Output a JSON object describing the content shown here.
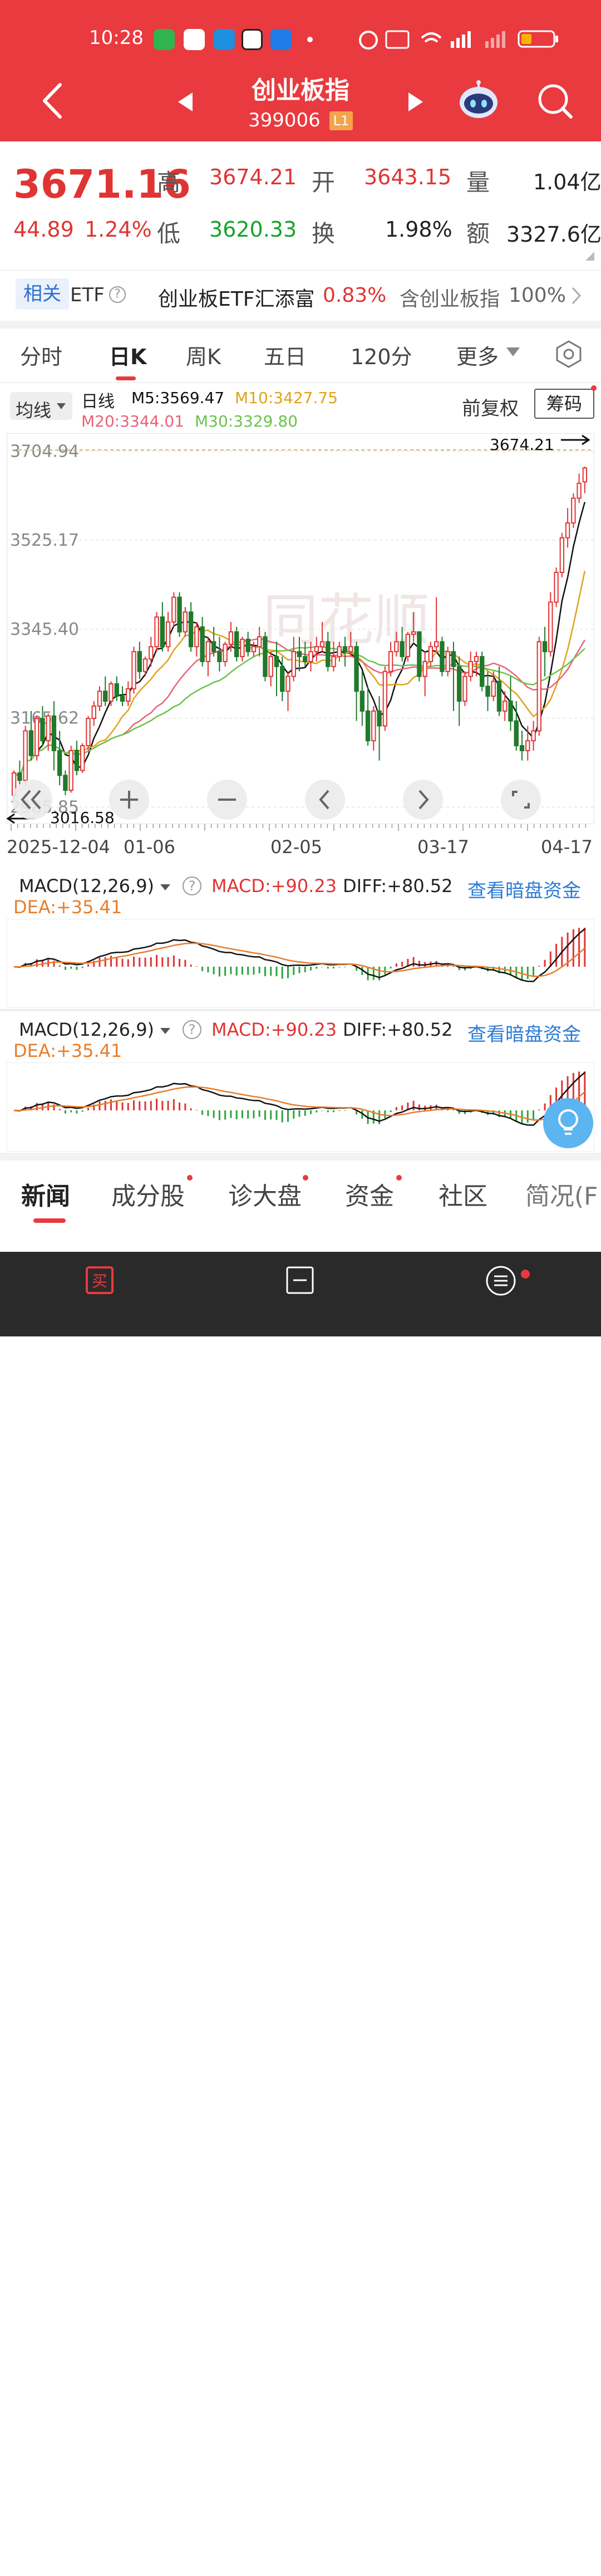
{
  "status_bar": {
    "time": "10:28",
    "icons": [
      "phone-icon",
      "home-app-icon",
      "radar-app-icon",
      "mail-app-icon",
      "alipay-icon",
      "alarm-icon",
      "hd-icon",
      "wifi-icon",
      "signal-icon",
      "battery-icon"
    ]
  },
  "header": {
    "title": "创业板指",
    "code": "399006",
    "level_badge": "L1"
  },
  "quote": {
    "price": "3671.16",
    "change": "44.89",
    "change_pct": "1.24%",
    "high_label": "高",
    "high": "3674.21",
    "low_label": "低",
    "low": "3620.33",
    "open_label": "开",
    "open": "3643.15",
    "turnover_label": "换",
    "turnover": "1.98%",
    "volume_label": "量",
    "volume": "1.04亿",
    "amount_label": "额",
    "amount": "3327.6亿"
  },
  "etf_bar": {
    "tag": "相关",
    "etf": "ETF",
    "name": "创业板ETF汇添富",
    "pct": "0.83%",
    "contains": "含创业板指",
    "contains_pct": "100%"
  },
  "chart_tabs": [
    "分时",
    "日K",
    "周K",
    "五日",
    "120分",
    "更多"
  ],
  "selected_tab": "日K",
  "ma_bar": {
    "select": "均线",
    "period": "日线",
    "m5": "M5:3569.47",
    "m10": "M10:3427.75",
    "m20": "M20:3344.01",
    "m30": "M30:3329.80",
    "fuquan": "前复权",
    "chouma": "筹码"
  },
  "kchart": {
    "y_labels": [
      "3704.94",
      "3525.17",
      "3345.40",
      "3165.62",
      "2985.85"
    ],
    "high_marker": "3674.21",
    "low_marker": "3016.58",
    "x_labels": [
      "2025-12-04",
      "01-06",
      "02-05",
      "03-17",
      "04-17"
    ],
    "watermark": "同花顺",
    "colors": {
      "up": "#e03434",
      "down": "#1f7a2a",
      "ma5": "#111111",
      "ma10": "#e0a21a",
      "ma20": "#e7647a",
      "ma30": "#6dc24b"
    }
  },
  "chart_data": {
    "type": "candlestick",
    "x_labels": [
      "2025-12-04",
      "01-06",
      "02-05",
      "03-17",
      "04-17"
    ],
    "y_ticks": [
      3704.94,
      3525.17,
      3345.4,
      3165.62,
      2985.85
    ],
    "ylim": [
      2965,
      3730
    ],
    "last_close": 3671.16,
    "period_high": 3674.21,
    "period_low": 3016.58,
    "series_ma": [
      {
        "name": "M5",
        "last": 3569.47
      },
      {
        "name": "M10",
        "last": 3427.75
      },
      {
        "name": "M20",
        "last": 3344.01
      },
      {
        "name": "M30",
        "last": 3329.8
      }
    ],
    "candles": [
      [
        3010,
        3060,
        3055,
        3000
      ],
      [
        3055,
        3080,
        3040,
        3030
      ],
      [
        3040,
        3150,
        3140,
        3030
      ],
      [
        3140,
        3180,
        3090,
        3080
      ],
      [
        3090,
        3170,
        3165,
        3080
      ],
      [
        3165,
        3190,
        3120,
        3110
      ],
      [
        3120,
        3175,
        3170,
        3100
      ],
      [
        3170,
        3200,
        3100,
        3060
      ],
      [
        3100,
        3140,
        3050,
        3030
      ],
      [
        3050,
        3060,
        3020,
        3010
      ],
      [
        3020,
        3110,
        3100,
        3015
      ],
      [
        3100,
        3120,
        3060,
        3050
      ],
      [
        3060,
        3115,
        3110,
        3055
      ],
      [
        3110,
        3170,
        3165,
        3100
      ],
      [
        3165,
        3200,
        3190,
        3150
      ],
      [
        3190,
        3230,
        3220,
        3180
      ],
      [
        3220,
        3250,
        3200,
        3190
      ],
      [
        3200,
        3240,
        3235,
        3190
      ],
      [
        3235,
        3250,
        3210,
        3200
      ],
      [
        3210,
        3230,
        3200,
        3190
      ],
      [
        3200,
        3240,
        3225,
        3190
      ],
      [
        3225,
        3310,
        3300,
        3215
      ],
      [
        3300,
        3320,
        3260,
        3245
      ],
      [
        3260,
        3290,
        3285,
        3250
      ],
      [
        3285,
        3330,
        3310,
        3270
      ],
      [
        3310,
        3380,
        3370,
        3300
      ],
      [
        3370,
        3400,
        3310,
        3300
      ],
      [
        3310,
        3380,
        3360,
        3300
      ],
      [
        3360,
        3420,
        3410,
        3350
      ],
      [
        3410,
        3420,
        3340,
        3330
      ],
      [
        3340,
        3390,
        3380,
        3330
      ],
      [
        3380,
        3400,
        3310,
        3300
      ],
      [
        3310,
        3360,
        3350,
        3290
      ],
      [
        3350,
        3370,
        3280,
        3270
      ],
      [
        3280,
        3330,
        3320,
        3250
      ],
      [
        3320,
        3350,
        3300,
        3290
      ],
      [
        3300,
        3330,
        3280,
        3260
      ],
      [
        3280,
        3320,
        3315,
        3270
      ],
      [
        3315,
        3360,
        3340,
        3300
      ],
      [
        3340,
        3350,
        3290,
        3280
      ],
      [
        3290,
        3330,
        3325,
        3280
      ],
      [
        3325,
        3340,
        3300,
        3290
      ],
      [
        3300,
        3320,
        3310,
        3290
      ],
      [
        3310,
        3350,
        3330,
        3290
      ],
      [
        3330,
        3340,
        3250,
        3240
      ],
      [
        3250,
        3300,
        3290,
        3230
      ],
      [
        3290,
        3320,
        3270,
        3210
      ],
      [
        3270,
        3290,
        3220,
        3200
      ],
      [
        3220,
        3260,
        3250,
        3180
      ],
      [
        3250,
        3330,
        3300,
        3240
      ],
      [
        3300,
        3330,
        3290,
        3260
      ],
      [
        3290,
        3320,
        3280,
        3270
      ],
      [
        3280,
        3320,
        3300,
        3260
      ],
      [
        3300,
        3330,
        3310,
        3280
      ],
      [
        3310,
        3360,
        3320,
        3300
      ],
      [
        3320,
        3340,
        3270,
        3260
      ],
      [
        3270,
        3320,
        3290,
        3260
      ],
      [
        3290,
        3320,
        3310,
        3280
      ],
      [
        3310,
        3330,
        3300,
        3270
      ],
      [
        3300,
        3340,
        3310,
        3290
      ],
      [
        3310,
        3320,
        3220,
        3160
      ],
      [
        3220,
        3260,
        3180,
        3150
      ],
      [
        3180,
        3230,
        3120,
        3110
      ],
      [
        3120,
        3190,
        3180,
        3100
      ],
      [
        3180,
        3210,
        3150,
        3080
      ],
      [
        3150,
        3270,
        3260,
        3140
      ],
      [
        3260,
        3320,
        3300,
        3250
      ],
      [
        3300,
        3340,
        3320,
        3290
      ],
      [
        3320,
        3350,
        3290,
        3280
      ],
      [
        3290,
        3340,
        3335,
        3280
      ],
      [
        3335,
        3380,
        3340,
        3320
      ],
      [
        3340,
        3340,
        3250,
        3240
      ],
      [
        3250,
        3300,
        3280,
        3210
      ],
      [
        3280,
        3320,
        3310,
        3270
      ],
      [
        3310,
        3410,
        3320,
        3300
      ],
      [
        3320,
        3330,
        3260,
        3250
      ],
      [
        3260,
        3310,
        3300,
        3250
      ],
      [
        3300,
        3320,
        3270,
        3180
      ],
      [
        3270,
        3290,
        3200,
        3150
      ],
      [
        3200,
        3260,
        3250,
        3190
      ],
      [
        3250,
        3300,
        3280,
        3240
      ],
      [
        3280,
        3300,
        3290,
        3250
      ],
      [
        3290,
        3300,
        3230,
        3220
      ],
      [
        3230,
        3260,
        3210,
        3180
      ],
      [
        3210,
        3260,
        3240,
        3200
      ],
      [
        3240,
        3270,
        3180,
        3170
      ],
      [
        3180,
        3220,
        3200,
        3160
      ],
      [
        3200,
        3250,
        3160,
        3140
      ],
      [
        3160,
        3200,
        3110,
        3100
      ],
      [
        3110,
        3140,
        3100,
        3080
      ],
      [
        3100,
        3150,
        3120,
        3080
      ],
      [
        3120,
        3160,
        3140,
        3100
      ],
      [
        3140,
        3330,
        3320,
        3130
      ],
      [
        3320,
        3350,
        3300,
        3250
      ],
      [
        3300,
        3420,
        3400,
        3290
      ],
      [
        3400,
        3470,
        3460,
        3390
      ],
      [
        3460,
        3540,
        3530,
        3450
      ],
      [
        3530,
        3590,
        3560,
        3510
      ],
      [
        3560,
        3620,
        3610,
        3550
      ],
      [
        3610,
        3660,
        3640,
        3600
      ],
      [
        3643,
        3674,
        3671,
        3620
      ]
    ]
  },
  "macd_panels": [
    {
      "label": "MACD(12,26,9)",
      "macd": "MACD:+90.23",
      "diff": "DIFF:+80.52",
      "dea": "DEA:+35.41",
      "link": "查看暗盘资金"
    },
    {
      "label": "MACD(12,26,9)",
      "macd": "MACD:+90.23",
      "diff": "DIFF:+80.52",
      "dea": "DEA:+35.41",
      "link": "查看暗盘资金"
    }
  ],
  "news_tabs": [
    "新闻",
    "成分股",
    "诊大盘",
    "资金",
    "社区",
    "简况(F"
  ],
  "bottom_nav": [
    {
      "label": "买指数",
      "icon": "buy-icon"
    },
    {
      "label": "删自选",
      "icon": "minus-box-icon"
    },
    {
      "label": "功能",
      "icon": "menu-circle-icon"
    }
  ]
}
